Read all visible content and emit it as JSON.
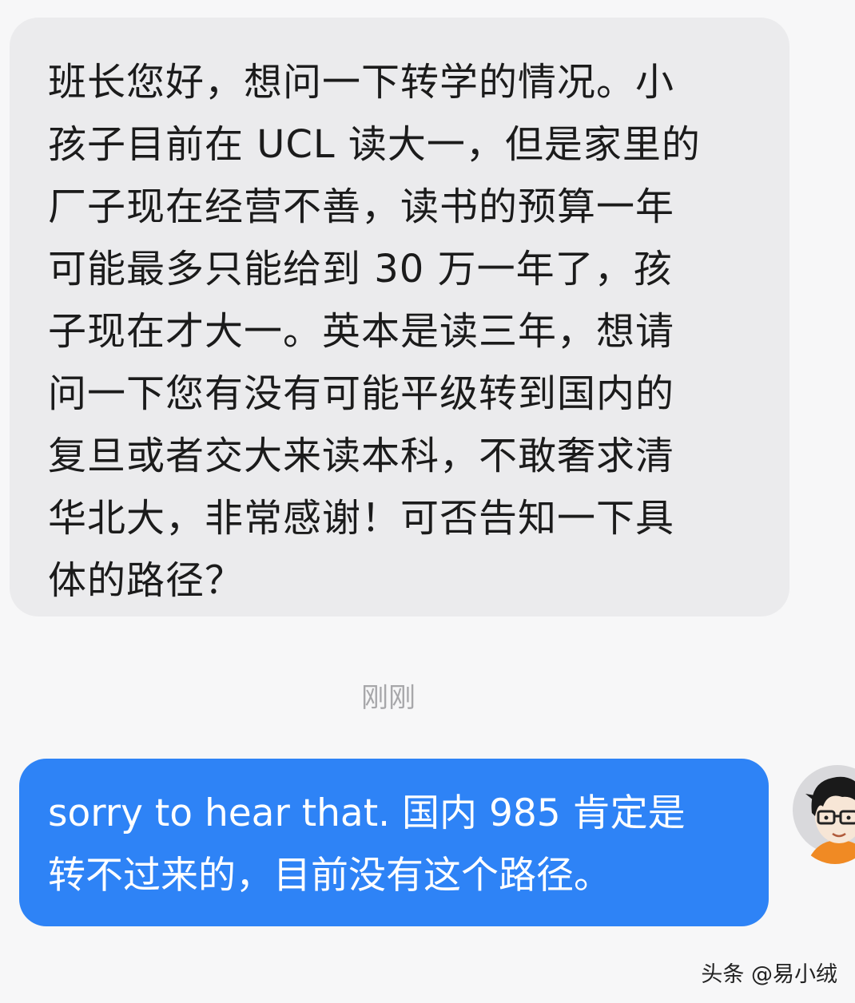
{
  "messages": {
    "incoming": {
      "text": "班长您好，想问一下转学的情况。小\n孩子目前在 UCL 读大一，但是家里的\n厂子现在经营不善，读书的预算一年\n可能最多只能给到 30 万一年了，孩\n子现在才大一。英本是读三年，想请\n问一下您有没有可能平级转到国内的\n复旦或者交大来读本科，不敢奢求清\n华北大，非常感谢！可否告知一下具\n体的路径？"
    },
    "timestamp": "刚刚",
    "outgoing": {
      "text": "sorry to hear that. 国内 985 肯定是\n转不过来的，目前没有这个路径。"
    }
  },
  "watermark": "头条 @易小绒",
  "colors": {
    "incoming_bubble": "#ebebed",
    "outgoing_bubble": "#2e83f6",
    "background": "#f7f7f8",
    "timestamp": "#a7a7aa"
  },
  "icons": {
    "avatar": "cartoon-boy-avatar-icon"
  }
}
